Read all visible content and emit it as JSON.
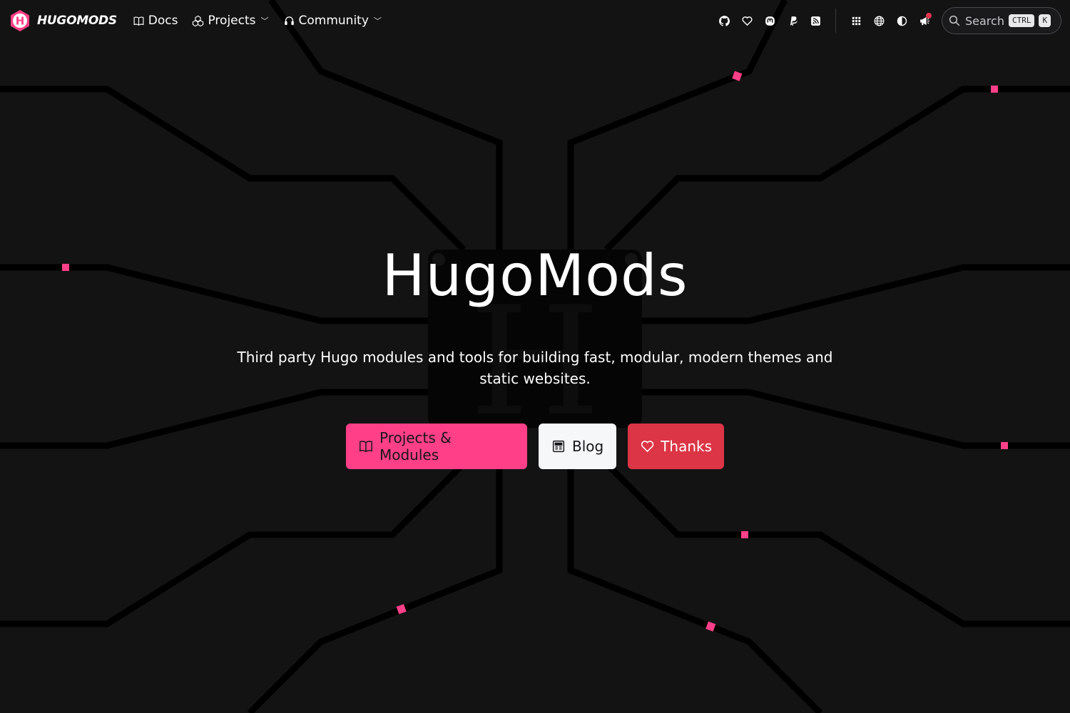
{
  "brand": {
    "name": "HUGOMODS",
    "logo_icon": "hugomods-hexagon-logo",
    "accent": "#ff4088"
  },
  "nav": {
    "links": [
      {
        "label": "Docs",
        "icon": "book-icon"
      },
      {
        "label": "Projects",
        "icon": "boxes-icon",
        "dropdown": true
      },
      {
        "label": "Community",
        "icon": "headset-icon",
        "dropdown": true
      }
    ],
    "caret": "﹀"
  },
  "toolbar": {
    "icons": [
      "github-icon",
      "heart-icon",
      "mastodon-icon",
      "paypal-icon",
      "rss-icon",
      "apps-grid-icon",
      "globe-icon",
      "contrast-icon",
      "megaphone-icon"
    ],
    "notification": true
  },
  "search": {
    "label": "Search",
    "key1": "CTRL",
    "key2": "K"
  },
  "hero": {
    "title": "HugoMods",
    "subtitle": "Third party Hugo modules and tools for building fast, modular, modern themes and static websites."
  },
  "buttons": {
    "projects": "Projects & Modules",
    "blog": "Blog",
    "thanks": "Thanks"
  },
  "colors": {
    "background": "#131314",
    "primary": "#ff4088",
    "danger": "#dc3545",
    "light": "#f6f7f9"
  }
}
